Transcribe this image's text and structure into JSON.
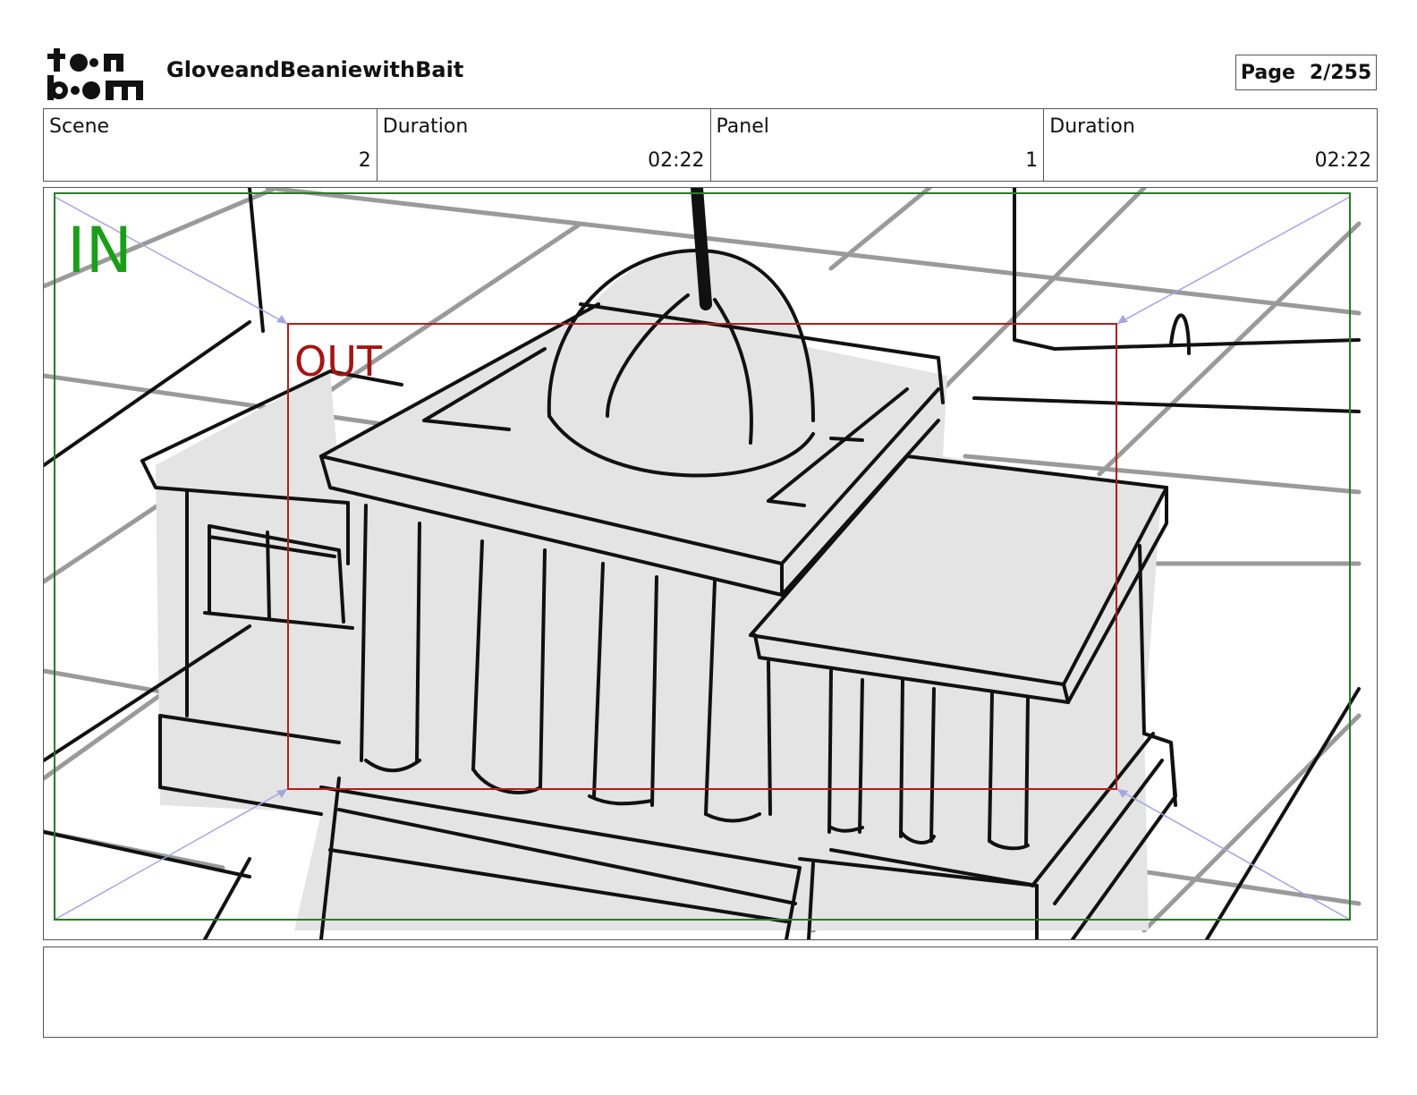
{
  "header": {
    "logo_text": "toon boom",
    "project_title": "GloveandBeaniewithBait",
    "page_label": "Page",
    "page_number": "2/255"
  },
  "info": {
    "scene_label": "Scene",
    "scene_value": "2",
    "scene_duration_label": "Duration",
    "scene_duration_value": "02:22",
    "panel_label": "Panel",
    "panel_value": "1",
    "panel_duration_label": "Duration",
    "panel_duration_value": "02:22"
  },
  "panel": {
    "in_label": "IN",
    "out_label": "OUT",
    "in_color": "#1a9e1a",
    "out_color": "#a31515",
    "in_frame_color": "#2a7a2a",
    "out_frame_color": "#b01e1e"
  },
  "notes": {
    "text": ""
  }
}
